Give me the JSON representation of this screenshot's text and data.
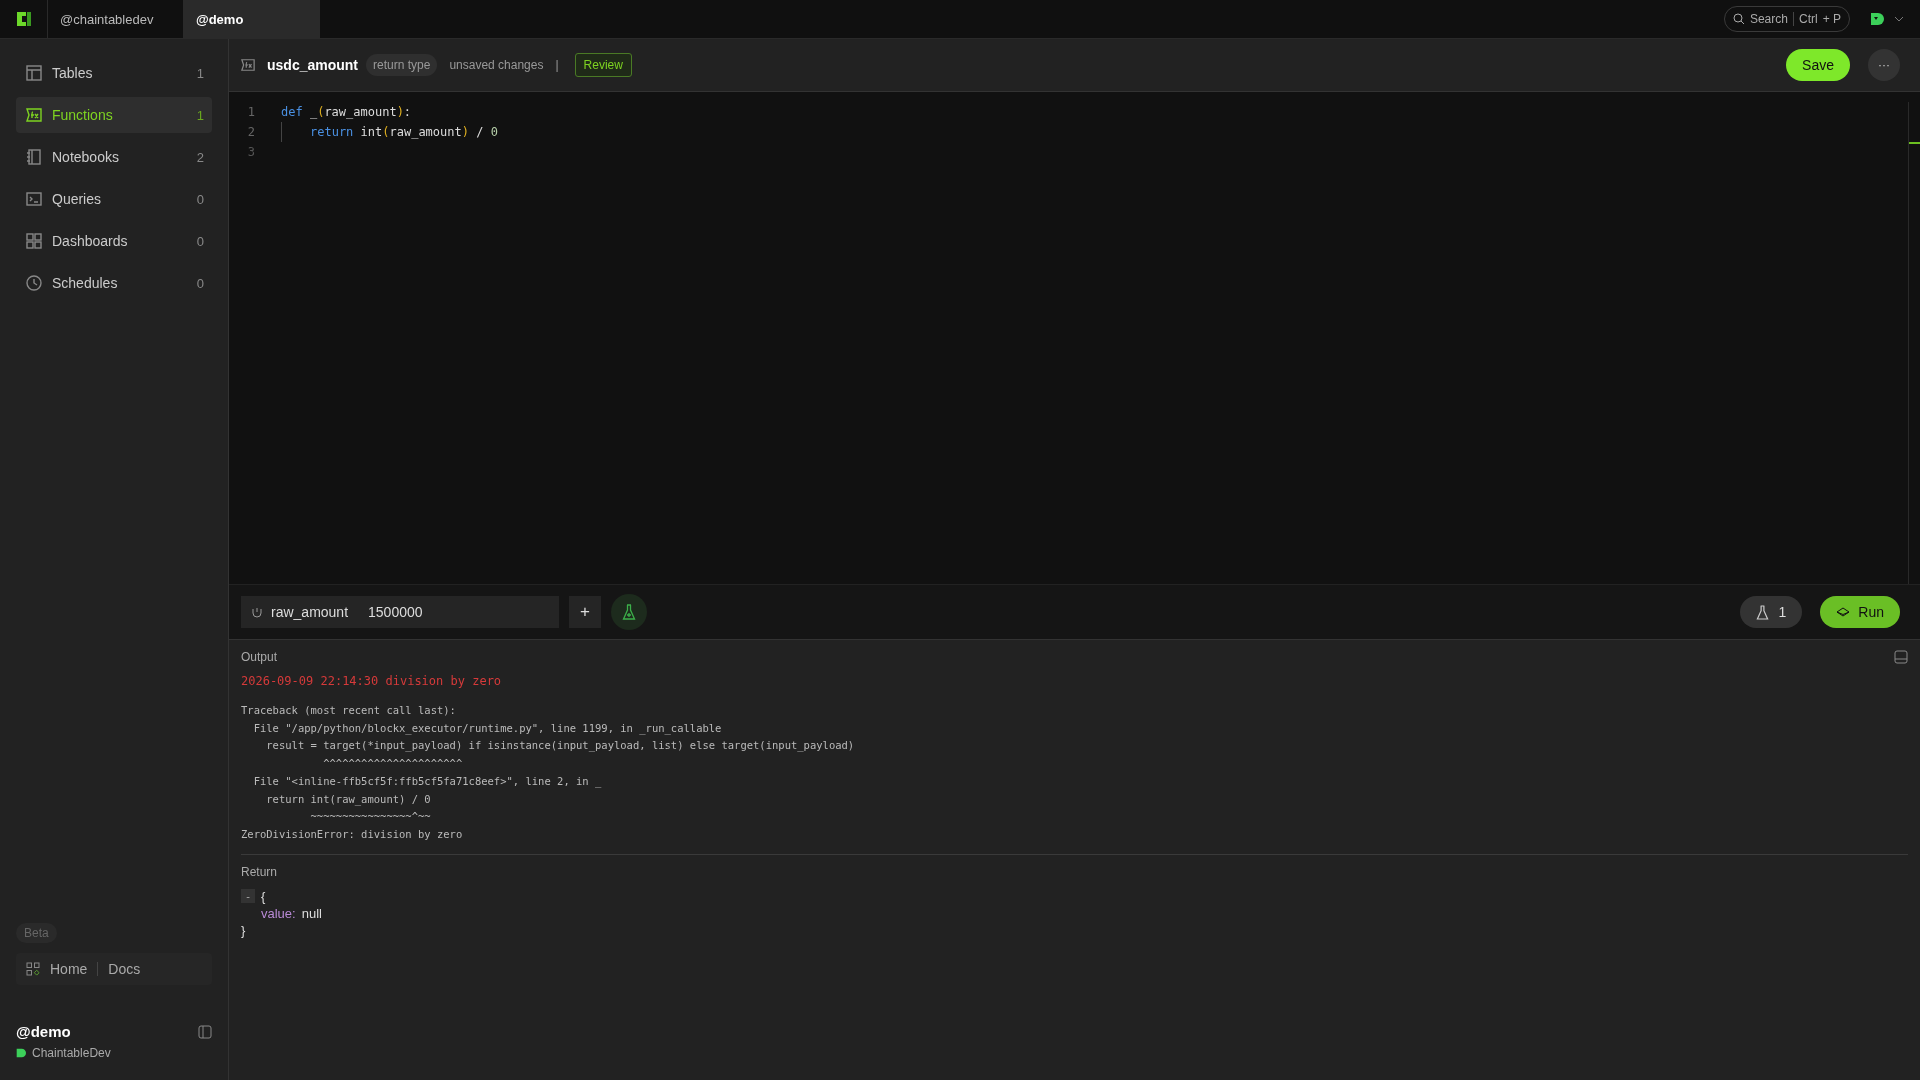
{
  "top_bar": {
    "tabs": [
      {
        "label": "@chaintabledev",
        "selected": false
      },
      {
        "label": "@demo",
        "selected": true
      }
    ],
    "search": {
      "label": "Search",
      "shortcut_key": "Ctrl",
      "shortcut_plus": "+ P"
    }
  },
  "sidebar": {
    "items": [
      {
        "label": "Tables",
        "count": "1",
        "kind": "table",
        "selected": false
      },
      {
        "label": "Functions",
        "count": "1",
        "kind": "function",
        "selected": true
      },
      {
        "label": "Notebooks",
        "count": "2",
        "kind": "notebook",
        "selected": false
      },
      {
        "label": "Queries",
        "count": "0",
        "kind": "query",
        "selected": false
      },
      {
        "label": "Dashboards",
        "count": "0",
        "kind": "dashboard",
        "selected": false
      },
      {
        "label": "Schedules",
        "count": "0",
        "kind": "schedule",
        "selected": false
      }
    ],
    "beta_badge": "Beta",
    "links": [
      "Home",
      "Docs"
    ],
    "workspace": "@demo",
    "account": "ChaintableDev"
  },
  "editor": {
    "name": "usdc_amount",
    "return_type": "return type",
    "status": "unsaved changes",
    "separator": "|",
    "review": "Review",
    "save": "Save",
    "more": "···",
    "lines": [
      {
        "number": "1",
        "tokens": [
          {
            "text": "def",
            "kind": "keyword"
          },
          {
            "text": " _",
            "kind": "name"
          },
          {
            "text": "(",
            "kind": "paren"
          },
          {
            "text": "raw_amount",
            "kind": "name"
          },
          {
            "text": ")",
            "kind": "paren"
          },
          {
            "text": ":",
            "kind": "name"
          }
        ]
      },
      {
        "number": "2",
        "indented": true,
        "tokens": [
          {
            "text": "return",
            "kind": "keyword"
          },
          {
            "text": " int",
            "kind": "name"
          },
          {
            "text": "(",
            "kind": "paren"
          },
          {
            "text": "raw_amount",
            "kind": "name"
          },
          {
            "text": ")",
            "kind": "paren"
          },
          {
            "text": " / ",
            "kind": "name"
          },
          {
            "text": "0",
            "kind": "number"
          }
        ]
      },
      {
        "number": "3"
      }
    ]
  },
  "inputs": {
    "params": [
      {
        "name": "raw_amount",
        "value": "1500000"
      }
    ],
    "add": "+",
    "tests_count": "1",
    "run": "Run"
  },
  "output": {
    "title": "Output",
    "error_header": "2026-09-09 22:14:30 division by zero",
    "traceback": [
      "Traceback (most recent call last):",
      "  File \"/app/python/blockx_executor/runtime.py\", line 1199, in _run_callable",
      "    result = target(*input_payload) if isinstance(input_payload, list) else target(input_payload)",
      "             ^^^^^^^^^^^^^^^^^^^^^^",
      "  File \"<inline-ffb5cf5f:ffb5cf5fa71c8eef>\", line 2, in _",
      "    return int(raw_amount) / 0",
      "           ~~~~~~~~~~~~~~~~^~~",
      "ZeroDivisionError: division by zero"
    ],
    "return_title": "Return",
    "collapse": "-",
    "open_brace": "{",
    "close_brace": "}",
    "return_key": "value:",
    "return_value": "null"
  }
}
